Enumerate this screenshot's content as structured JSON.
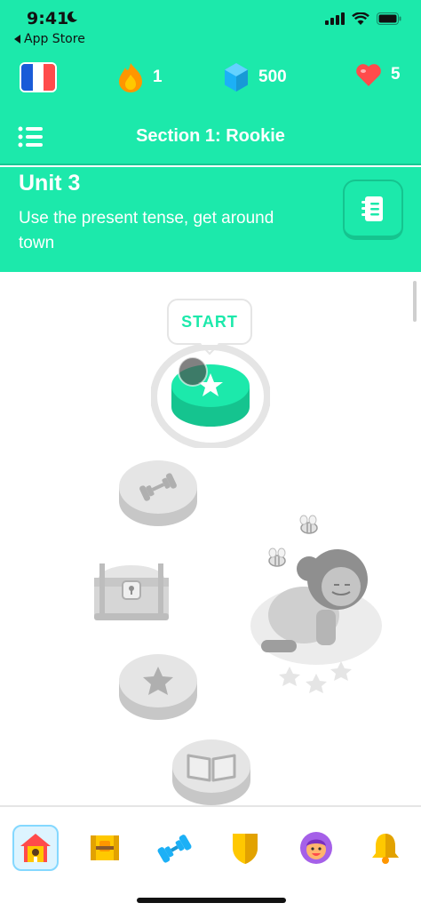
{
  "status_bar": {
    "time": "9:41",
    "back_label": "App Store"
  },
  "stats": {
    "language_flag": "french-flag-icon",
    "streak_count": "1",
    "gems_count": "500",
    "hearts_count": "5"
  },
  "section": {
    "title": "Section 1: Rookie"
  },
  "unit": {
    "title": "Unit 3",
    "description": "Use the present tense, get around town"
  },
  "path": {
    "start_label": "START",
    "nodes": [
      "star-lesson",
      "practice-dumbbell",
      "treasure-chest",
      "star-lesson-locked",
      "story-book"
    ]
  },
  "bottom_nav": {
    "items": [
      "home-icon",
      "leagues-chest-icon",
      "practice-hub-icon",
      "shield-icon",
      "profile-avatar-icon",
      "notifications-bell-icon"
    ],
    "active": "home-icon"
  },
  "colors": {
    "brand_green": "#1ce9ab",
    "dark_green": "#15c48f",
    "locked_gray": "#e5e5e5",
    "flame_orange": "#ff9600",
    "gem_blue": "#1cb0f6",
    "heart_red": "#ff4b4b"
  }
}
